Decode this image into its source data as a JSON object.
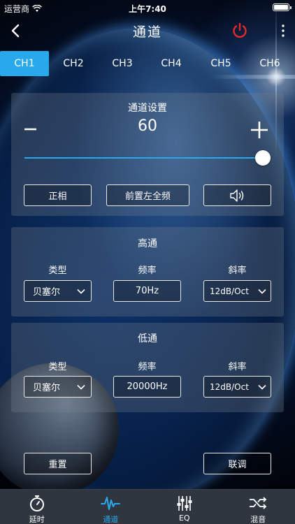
{
  "status_bar": {
    "carrier": "运营商",
    "time": "上午7:40"
  },
  "nav": {
    "title": "通道"
  },
  "tabs": [
    "CH1",
    "CH2",
    "CH3",
    "CH4",
    "CH5",
    "CH6"
  ],
  "channel_settings": {
    "title": "通道设置",
    "value": "60",
    "minus": "−",
    "plus": "+",
    "slider_fraction": 1.0,
    "phase_button": "正相",
    "position_button": "前置左全频",
    "speaker_icon": "speaker-icon"
  },
  "high_pass": {
    "title": "高通",
    "type_label": "类型",
    "freq_label": "频率",
    "slope_label": "斜率",
    "type_value": "贝塞尔",
    "freq_value": "70Hz",
    "slope_value": "12dB/Oct"
  },
  "low_pass": {
    "title": "低通",
    "type_label": "类型",
    "freq_label": "频率",
    "slope_label": "斜率",
    "type_value": "贝塞尔",
    "freq_value": "20000Hz",
    "slope_value": "12dB/Oct"
  },
  "actions": {
    "reset": "重置",
    "link": "联调"
  },
  "tabbar": [
    {
      "label": "延时",
      "icon": "stopwatch-icon"
    },
    {
      "label": "通道",
      "icon": "waveform-icon"
    },
    {
      "label": "EQ",
      "icon": "equalizer-icon"
    },
    {
      "label": "混音",
      "icon": "shuffle-icon"
    }
  ],
  "colors": {
    "accent": "#29a9ec",
    "power": "#e02b2b",
    "tabbar_bg": "#303640"
  }
}
